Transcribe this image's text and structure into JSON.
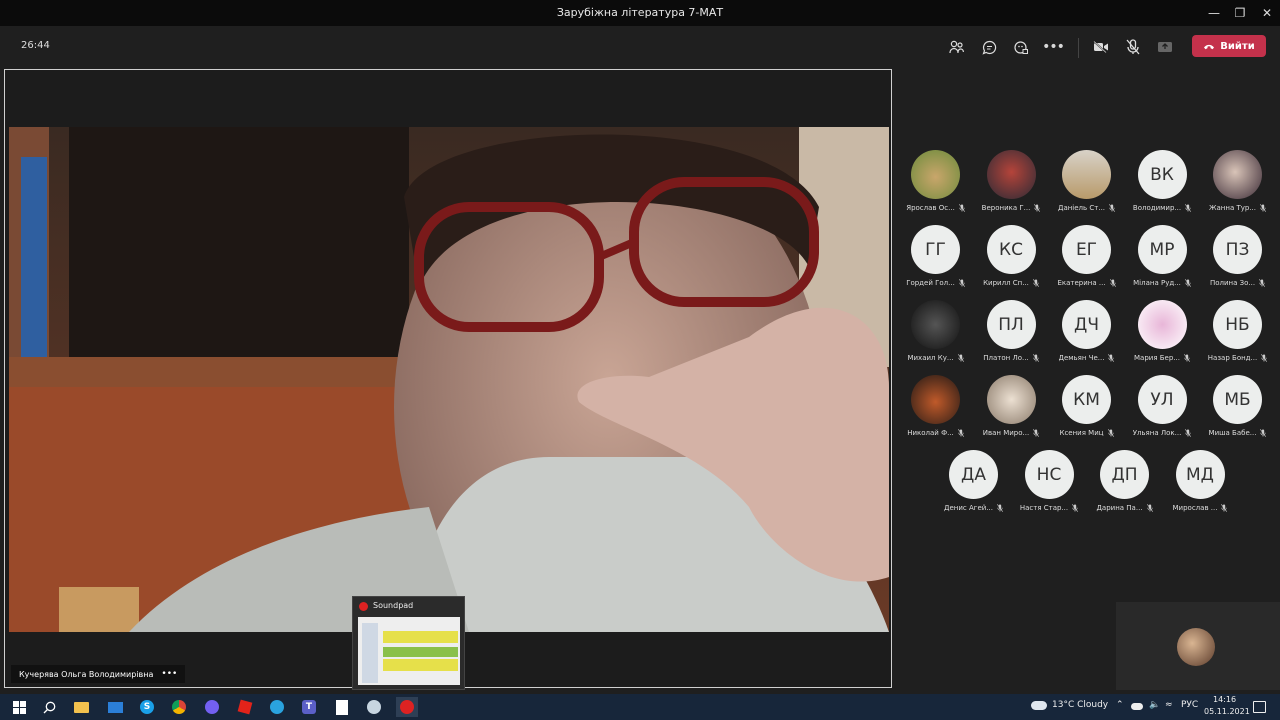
{
  "window": {
    "title": "Зарубіжна література 7-МАТ"
  },
  "call": {
    "timer": "26:44",
    "leave_label": "Вийти"
  },
  "presenter": {
    "name": "Кучерява Ольга Володимирівна"
  },
  "participants": [
    {
      "name": "Ярослав Ос...",
      "initials": "",
      "photo": true
    },
    {
      "name": "Вероника Г...",
      "initials": "",
      "photo": true
    },
    {
      "name": "Даніель Ст...",
      "initials": "",
      "photo": true
    },
    {
      "name": "Володимир...",
      "initials": "ВК",
      "photo": false
    },
    {
      "name": "Жанна Тур...",
      "initials": "",
      "photo": true
    },
    {
      "name": "Гордей Гол...",
      "initials": "ГГ",
      "photo": false
    },
    {
      "name": "Кирилл Сп...",
      "initials": "КС",
      "photo": false
    },
    {
      "name": "Екатерина ...",
      "initials": "ЕГ",
      "photo": false
    },
    {
      "name": "Мілана Руд...",
      "initials": "МР",
      "photo": false
    },
    {
      "name": "Полина Зо...",
      "initials": "ПЗ",
      "photo": false
    },
    {
      "name": "Михаил Ку...",
      "initials": "",
      "photo": true
    },
    {
      "name": "Платон Ло...",
      "initials": "ПЛ",
      "photo": false
    },
    {
      "name": "Демьян Че...",
      "initials": "ДЧ",
      "photo": false
    },
    {
      "name": "Мария Бер...",
      "initials": "",
      "photo": true
    },
    {
      "name": "Назар Бонд...",
      "initials": "НБ",
      "photo": false
    },
    {
      "name": "Николай Ф...",
      "initials": "",
      "photo": true
    },
    {
      "name": "Иван Миро...",
      "initials": "",
      "photo": true
    },
    {
      "name": "Ксения Миц",
      "initials": "КМ",
      "photo": false
    },
    {
      "name": "Ульяна Лок...",
      "initials": "УЛ",
      "photo": false
    },
    {
      "name": "Миша Бабе...",
      "initials": "МБ",
      "photo": false
    },
    {
      "name": "Денис Агей...",
      "initials": "ДА",
      "photo": false
    },
    {
      "name": "Настя Стар...",
      "initials": "НС",
      "photo": false
    },
    {
      "name": "Дарина Па...",
      "initials": "ДП",
      "photo": false
    },
    {
      "name": "Мирослав ...",
      "initials": "МД",
      "photo": false
    }
  ],
  "taskbar_preview": {
    "title": "Soundpad"
  },
  "tray": {
    "weather": "13°C  Cloudy",
    "lang": "РУС",
    "time": "14:16",
    "date": "05.11.2021"
  },
  "colors": {
    "leave": "#c4314b",
    "taskbar": "#17263a"
  }
}
